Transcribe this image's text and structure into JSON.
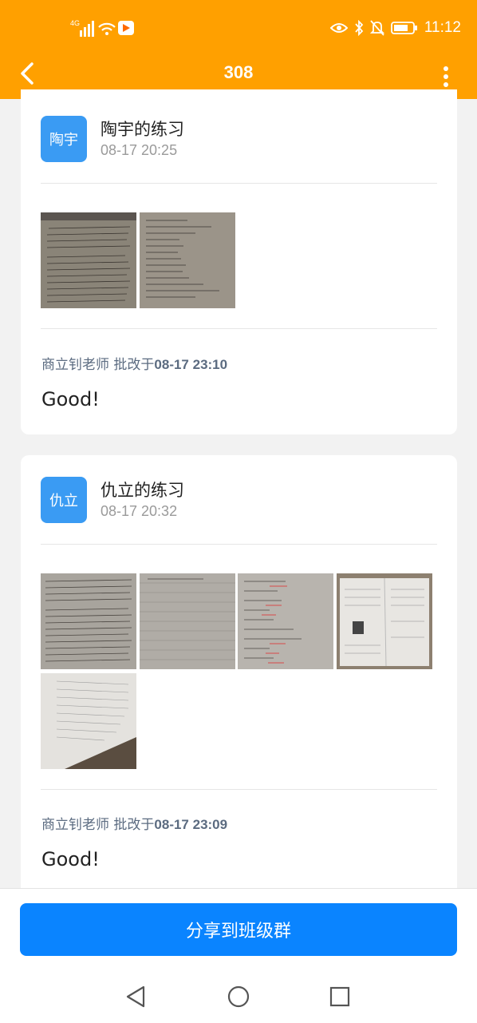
{
  "status_bar": {
    "network": "4G",
    "time": "11:12",
    "accent": "#ffa000"
  },
  "header": {
    "title": "308",
    "back_icon": "chevron-left-icon",
    "more_icon": "more-vertical-icon"
  },
  "submissions": [
    {
      "avatar_text": "陶宇",
      "name": "陶宇的练习",
      "time": "08-17 20:25",
      "image_count": 2,
      "reviewer_prefix": "商立钊老师 批改于",
      "review_time": "08-17 23:10",
      "comment": "Good!"
    },
    {
      "avatar_text": "仇立",
      "name": "仇立的练习",
      "time": "08-17 20:32",
      "image_count": 5,
      "reviewer_prefix": "商立钊老师 批改于",
      "review_time": "08-17 23:09",
      "comment": "Good!"
    }
  ],
  "share_button": {
    "label": "分享到班级群",
    "color": "#0a84ff"
  },
  "nav_bar": [
    "back-triangle-icon",
    "home-circle-icon",
    "recent-square-icon"
  ]
}
